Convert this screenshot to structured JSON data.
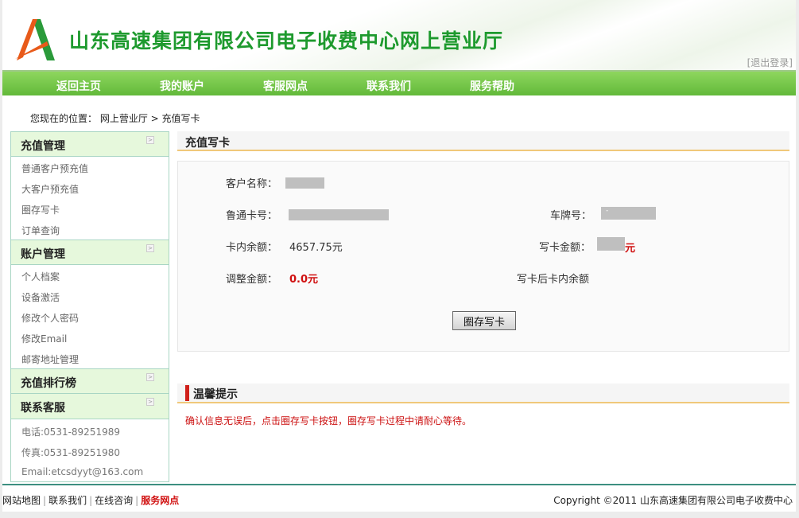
{
  "header": {
    "title": "山东高速集团有限公司电子收费中心网上营业厅",
    "logout": "[退出登录]"
  },
  "nav": [
    "返回主页",
    "我的账户",
    "客服网点",
    "联系我们",
    "服务帮助"
  ],
  "breadcrumb": "您现在的位置： 网上营业厅 > 充值写卡",
  "sidebar": {
    "recharge": {
      "title": "充值管理",
      "items": [
        "普通客户预充值",
        "大客户预充值",
        "圈存写卡",
        "订单查询"
      ]
    },
    "account": {
      "title": "账户管理",
      "items": [
        "个人档案",
        "设备激活",
        "修改个人密码",
        "修改Email",
        "邮寄地址管理"
      ]
    },
    "ranking": {
      "title": "充值排行榜"
    },
    "contact": {
      "title": "联系客服",
      "items": [
        "电话:0531-89251989",
        "传真:0531-89251980",
        "Email:etcsdyyt@163.com"
      ]
    }
  },
  "main": {
    "title": "充值写卡",
    "customer_name_label": "客户名称：",
    "card_no_label": "鲁通卡号：",
    "plate_label": "车牌号：",
    "plate_value": "-",
    "balance_label": "卡内余额：",
    "balance_value": "4657.75元",
    "write_amount_label": "写卡金额：",
    "write_amount_unit": "元",
    "adjust_label": "调整金额：",
    "adjust_value": "0.0元",
    "after_balance_label": "写卡后卡内余额",
    "button": "圈存写卡"
  },
  "tips": {
    "title": "温馨提示",
    "text": "确认信息无误后，点击圈存写卡按钮，圈存写卡过程中请耐心等待。"
  },
  "footer": {
    "links": [
      "网站地图",
      "联系我们",
      "在线咨询",
      "服务网点"
    ],
    "copyright": "Copyright ©2011 山东高速集团有限公司电子收费中心"
  }
}
